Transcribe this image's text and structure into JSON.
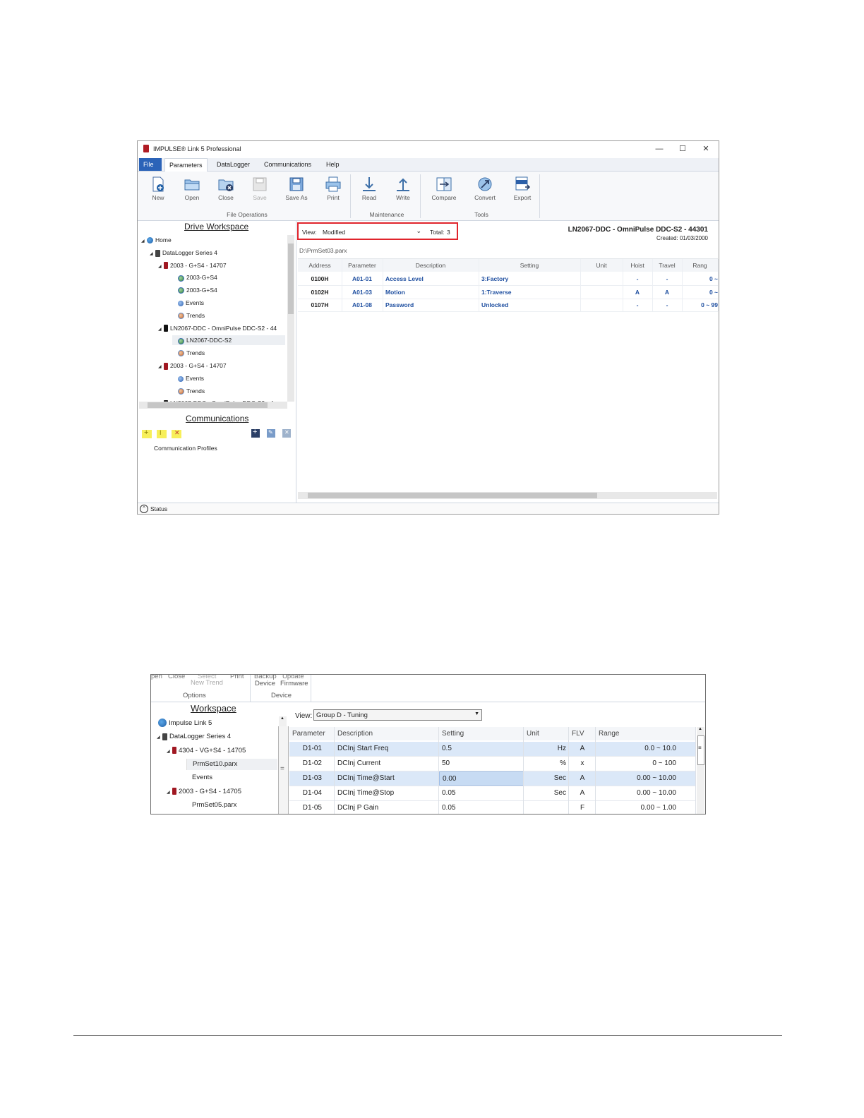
{
  "screenshot1": {
    "window_title": "IMPULSE® Link 5 Professional",
    "window_controls": {
      "minimize": "—",
      "maximize": "☐",
      "close": "✕"
    },
    "menu": [
      "File",
      "Parameters",
      "DataLogger",
      "Communications",
      "Help"
    ],
    "ribbon": {
      "buttons": [
        {
          "label": "New",
          "icon": "new-file-icon"
        },
        {
          "label": "Open",
          "icon": "open-folder-icon"
        },
        {
          "label": "Close",
          "icon": "close-folder-icon"
        },
        {
          "label": "Save",
          "icon": "save-icon"
        },
        {
          "label": "Save As",
          "icon": "save-as-icon"
        },
        {
          "label": "Print",
          "icon": "print-icon"
        },
        {
          "label": "Read",
          "icon": "read-arrow-down-icon"
        },
        {
          "label": "Write",
          "icon": "write-arrow-up-icon"
        },
        {
          "label": "Compare",
          "icon": "compare-icon"
        },
        {
          "label": "Convert",
          "icon": "convert-icon"
        },
        {
          "label": "Export",
          "icon": "export-csv-icon"
        }
      ],
      "groups": [
        "File Operations",
        "Maintenance",
        "Tools"
      ]
    },
    "workspace": {
      "header": "Drive Workspace",
      "tree": [
        {
          "label": "Home",
          "icon": "globe"
        },
        {
          "label": "DataLogger Series 4",
          "icon": "dl"
        },
        {
          "label": "2003 - G+S4 - 14707",
          "icon": "drive"
        },
        {
          "label": "2003-G+S4",
          "icon": "prm"
        },
        {
          "label": "2003-G+S4",
          "icon": "prm"
        },
        {
          "label": "Events",
          "icon": "ev"
        },
        {
          "label": "Trends",
          "icon": "tr"
        },
        {
          "label": "LN2067-DDC - OmniPulse DDC-S2 - 44",
          "icon": "dark"
        },
        {
          "label": "LN2067-DDC-S2",
          "icon": "prm"
        },
        {
          "label": "Trends",
          "icon": "tr"
        },
        {
          "label": "2003 - G+S4 - 14707",
          "icon": "drive"
        },
        {
          "label": "Events",
          "icon": "ev"
        },
        {
          "label": "Trends",
          "icon": "tr"
        },
        {
          "label": "LN2067-DDC - OmniPulse DDC-S2 - 4",
          "icon": "dark"
        }
      ]
    },
    "communications": {
      "header": "Communications",
      "profiles_label": "Communication Profiles"
    },
    "view_bar": {
      "view_label": "View:",
      "view_value": "Modified",
      "total_label": "Total:",
      "total_value": "3",
      "highlight_color": "#e0242c"
    },
    "drive_info": {
      "name": "LN2067-DDC - OmniPulse DDC-S2 - 44301",
      "created": "Created: 01/03/2000"
    },
    "file_path": "D:\\PrmSet03.parx",
    "table": {
      "headers": [
        "Address",
        "Parameter",
        "Description",
        "Setting",
        "Unit",
        "Hoist",
        "Travel",
        "Rang"
      ],
      "rows": [
        [
          "0100H",
          "A01-01",
          "Access Level",
          "3:Factory",
          "",
          "-",
          "-",
          "0 ~"
        ],
        [
          "0102H",
          "A01-03",
          "Motion",
          "1:Traverse",
          "",
          "A",
          "A",
          "0 ~"
        ],
        [
          "0107H",
          "A01-08",
          "Password",
          "Unlocked",
          "",
          "-",
          "-",
          "0 ~ 99"
        ]
      ]
    },
    "status": "Status"
  },
  "screenshot2": {
    "toolbar_labels": {
      "open": "pen",
      "close": "Close",
      "select": "Select",
      "print": "Print",
      "backup": "Backup",
      "update": "Update",
      "new_trend": "New Trend",
      "device": "Device",
      "firmware": "Firmware",
      "options_group": "Options",
      "device_group": "Device"
    },
    "workspace": {
      "header": "Workspace",
      "tree": [
        {
          "label": "Impulse Link 5",
          "icon": "globe"
        },
        {
          "label": "DataLogger Series 4",
          "icon": "dl"
        },
        {
          "label": "4304 - VG+S4 - 14705",
          "icon": "drive"
        },
        {
          "label": "PrmSet10.parx",
          "icon": "none"
        },
        {
          "label": "Events",
          "icon": "none"
        },
        {
          "label": "2003 - G+S4 - 14705",
          "icon": "drive"
        },
        {
          "label": "PrmSet05.parx",
          "icon": "none"
        }
      ]
    },
    "view_label": "View:",
    "view_value": "Group D - Tuning",
    "table": {
      "headers": [
        "Parameter",
        "Description",
        "Setting",
        "Unit",
        "FLV",
        "Range"
      ],
      "rows": [
        [
          "D1-01",
          "DCInj Start Freq",
          "0.5",
          "Hz",
          "A",
          "0.0 ~ 10.0"
        ],
        [
          "D1-02",
          "DCInj Current",
          "50",
          "%",
          "x",
          "0 ~ 100"
        ],
        [
          "D1-03",
          "DCInj Time@Start",
          "0.00",
          "Sec",
          "A",
          "0.00 ~ 10.00"
        ],
        [
          "D1-04",
          "DCInj Time@Stop",
          "0.05",
          "Sec",
          "A",
          "0.00 ~ 10.00"
        ],
        [
          "D1-05",
          "DCInj P Gain",
          "0.05",
          "",
          "F",
          "0.00 ~ 1.00"
        ]
      ]
    },
    "row_highlight_color": "#dbe8f8"
  }
}
